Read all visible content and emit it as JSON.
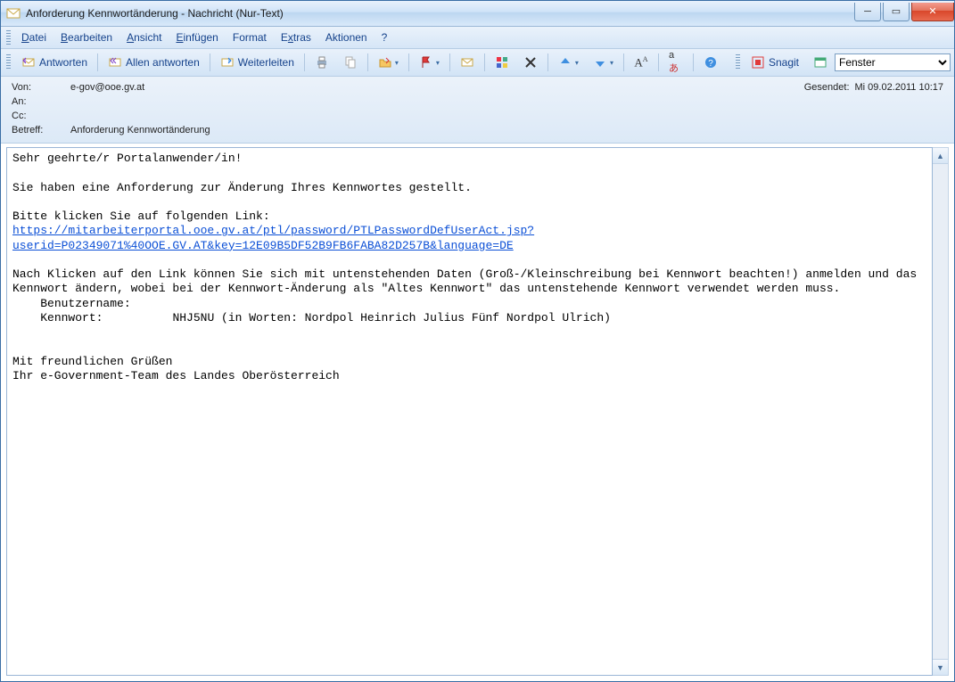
{
  "window": {
    "title": "Anforderung Kennwortänderung - Nachricht (Nur-Text)"
  },
  "menu": {
    "file": "Datei",
    "edit": "Bearbeiten",
    "view": "Ansicht",
    "insert": "Einfügen",
    "format": "Format",
    "extras": "Extras",
    "actions": "Aktionen",
    "help": "?"
  },
  "toolbar": {
    "reply": "Antworten",
    "reply_all": "Allen antworten",
    "forward": "Weiterleiten",
    "snagit": "Snagit",
    "snagit_scope": "Fenster"
  },
  "headers": {
    "from_label": "Von:",
    "from_value": "e-gov@ooe.gv.at",
    "to_label": "An:",
    "to_value": "",
    "cc_label": "Cc:",
    "cc_value": "",
    "subject_label": "Betreff:",
    "subject_value": "Anforderung Kennwortänderung",
    "sent_label": "Gesendet:",
    "sent_value": "Mi 09.02.2011 10:17"
  },
  "body": {
    "greeting": "Sehr geehrte/r Portalanwender/in!",
    "line1": "Sie haben eine Anforderung zur Änderung Ihres Kennwortes gestellt.",
    "line2": "Bitte klicken Sie auf folgenden Link:",
    "link": "https://mitarbeiterportal.ooe.gv.at/ptl/password/PTLPasswordDefUserAct.jsp?userid=P02349071%40OOE.GV.AT&key=12E09B5DF52B9FB6FABA82D257B&language=DE",
    "line3": "Nach Klicken auf den Link können Sie sich mit untenstehenden Daten (Groß-/Kleinschreibung bei Kennwort beachten!) anmelden und das Kennwort ändern, wobei bei der Kennwort-Änderung als \"Altes Kennwort\" das untenstehende Kennwort verwendet werden muss.",
    "user_label": "    Benutzername:      ",
    "pass_label": "    Kennwort:          NHJ5NU (in Worten: Nordpol Heinrich Julius Fünf Nordpol Ulrich)",
    "closing1": "Mit freundlichen Grüßen",
    "closing2": "Ihr e-Government-Team des Landes Oberösterreich"
  }
}
